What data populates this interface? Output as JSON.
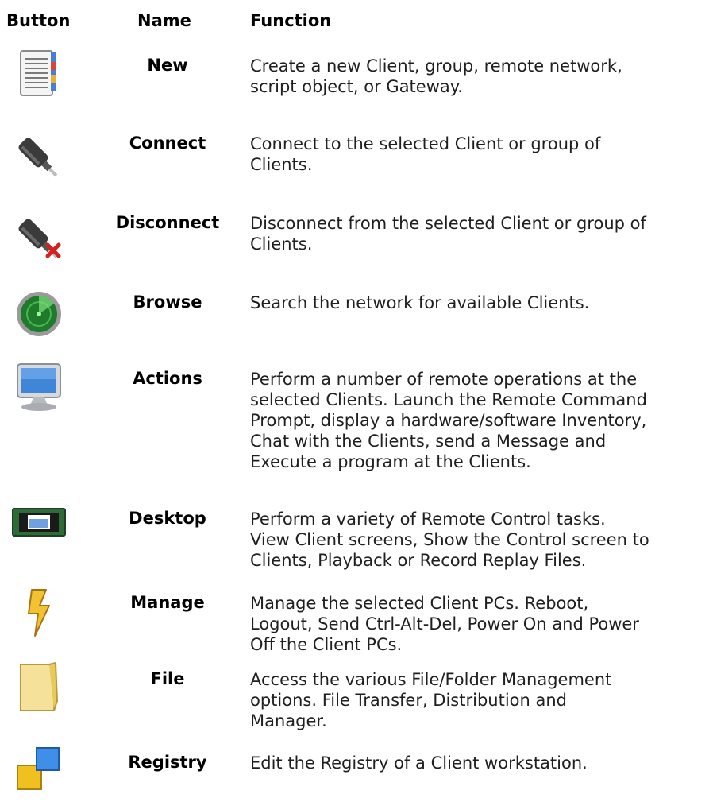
{
  "headers": {
    "button": "Button",
    "name": "Name",
    "function": "Function"
  },
  "rows": [
    {
      "icon": "notepad-icon",
      "name": "New",
      "lines": [
        "Create a new Client, group, remote network,",
        "script object, or Gateway."
      ]
    },
    {
      "icon": "plug-icon",
      "name": "Connect",
      "lines": [
        "Connect to the selected Client or group of",
        "Clients."
      ]
    },
    {
      "icon": "unplug-icon",
      "name": "Disconnect",
      "lines": [
        "Disconnect from the selected Client or group of",
        "Clients."
      ]
    },
    {
      "icon": "radar-icon",
      "name": "Browse",
      "lines": [
        "Search the network for available Clients."
      ]
    },
    {
      "icon": "monitor-icon",
      "name": "Actions",
      "lines": [
        "Perform a number of remote operations at the",
        "selected Clients. Launch the Remote Command",
        "Prompt, display a hardware/software Inventory,",
        "Chat with the Clients, send a Message and",
        "Execute a program at the Clients."
      ]
    },
    {
      "icon": "desktop-icon",
      "name": "Desktop",
      "lines": [
        "Perform a variety of Remote Control tasks.",
        "View Client screens, Show the Control screen to",
        "Clients, Playback or Record Replay Files."
      ]
    },
    {
      "icon": "lightning-icon",
      "name": "Manage",
      "lines": [
        "Manage the selected Client PCs. Reboot,",
        "Logout, Send Ctrl-Alt-Del, Power On and Power",
        "Off the Client PCs."
      ]
    },
    {
      "icon": "folder-icon",
      "name": "File",
      "lines": [
        "Access the various File/Folder Management",
        "options. File Transfer, Distribution and",
        "Manager."
      ]
    },
    {
      "icon": "registry-icon",
      "name": "Registry",
      "lines": [
        "Edit the Registry of a Client workstation."
      ]
    }
  ]
}
